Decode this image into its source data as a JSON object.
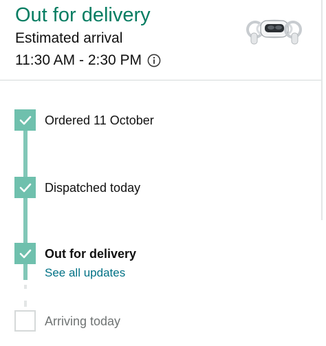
{
  "header": {
    "status_title": "Out for delivery",
    "arrival_label": "Estimated arrival",
    "arrival_time": "11:30 AM - 2:30 PM",
    "info_icon": "info-circle-icon",
    "product_image": "vr-headset-with-controllers"
  },
  "timeline": {
    "steps": [
      {
        "label": "Ordered 11 October",
        "completed": true
      },
      {
        "label": "Dispatched today",
        "completed": true
      },
      {
        "label": "Out for delivery",
        "completed": true,
        "current": true,
        "link": "See all updates"
      },
      {
        "label": "Arriving today",
        "completed": false
      }
    ]
  },
  "colors": {
    "status_green": "#067d62",
    "timeline_teal": "#6fc0ad",
    "link_blue": "#007185",
    "muted_text": "#6f7373"
  }
}
